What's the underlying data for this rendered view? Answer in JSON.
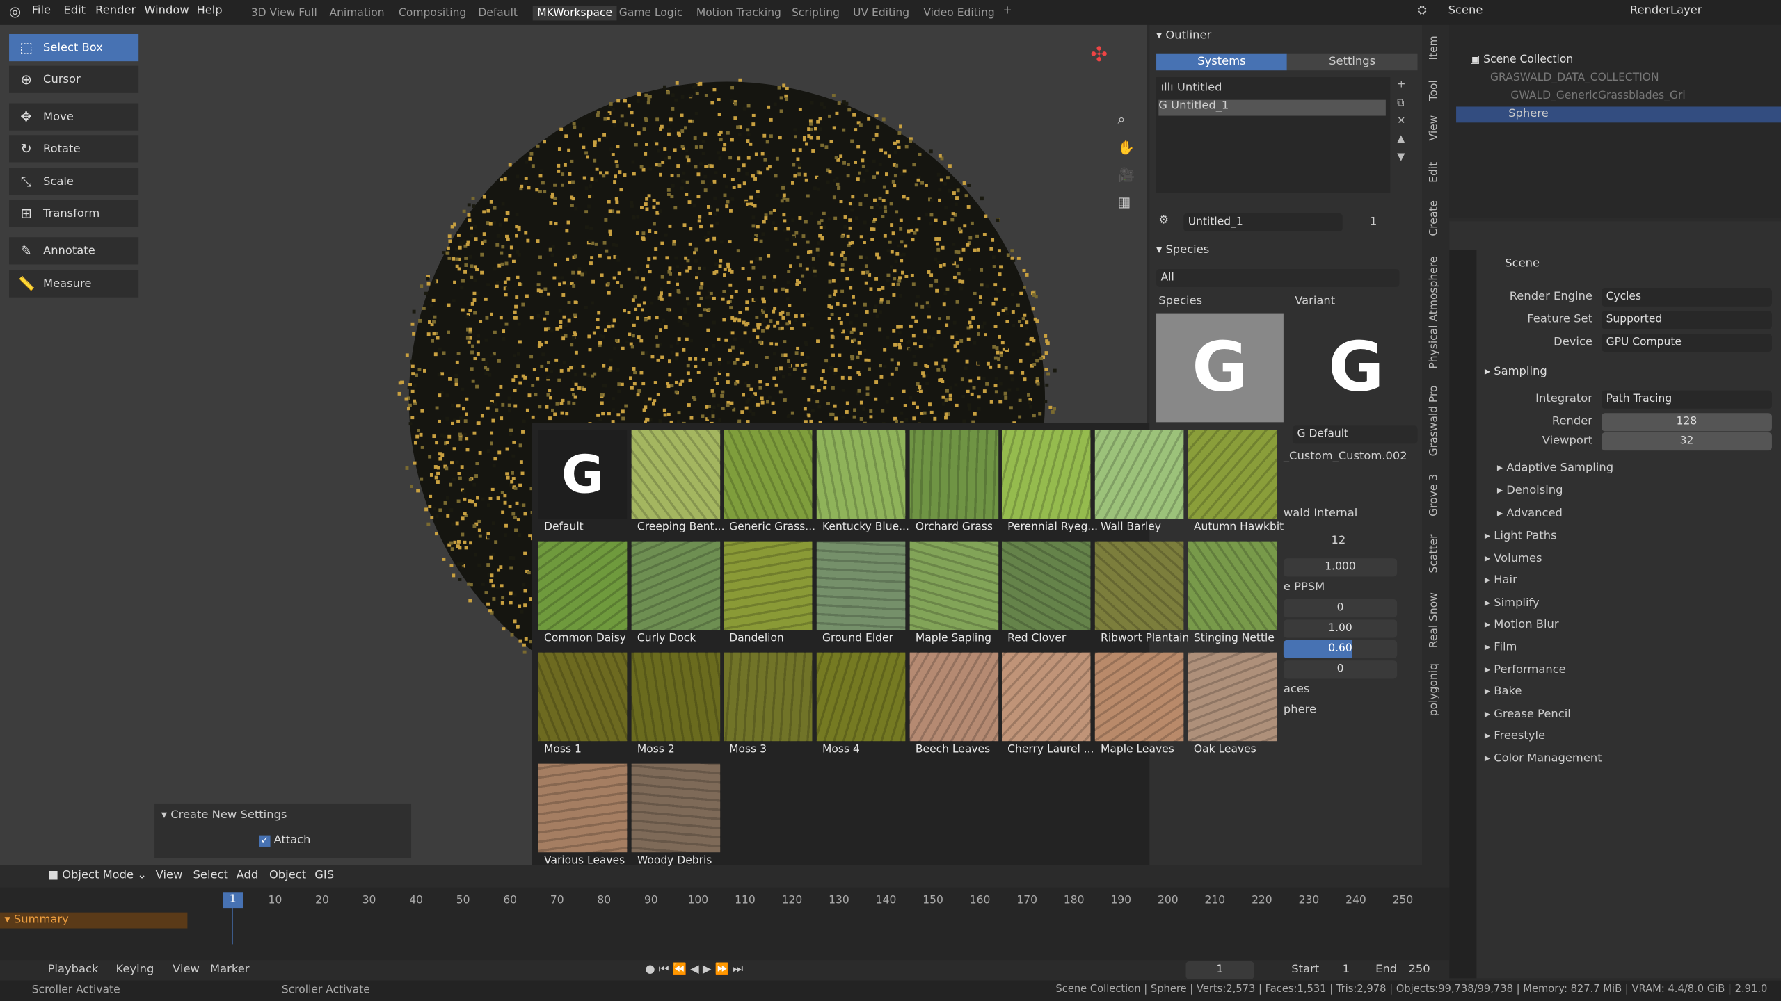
{
  "menu": [
    "File",
    "Edit",
    "Render",
    "Window",
    "Help"
  ],
  "workspaces": [
    "3D View Full",
    "Animation",
    "Compositing",
    "Default",
    "MKWorkspace",
    "Game Logic",
    "Motion Tracking",
    "Scripting",
    "UV Editing",
    "Video Editing"
  ],
  "active_workspace": "MKWorkspace",
  "scene": {
    "label": "Scene",
    "layer": "RenderLayer"
  },
  "tools": [
    "Select Box",
    "Cursor",
    "Move",
    "Rotate",
    "Scale",
    "Transform",
    "Annotate",
    "Measure"
  ],
  "tool_icons": [
    "select-box-icon",
    "cursor-icon",
    "move-icon",
    "rotate-icon",
    "scale-icon",
    "transform-icon",
    "annotate-icon",
    "measure-icon"
  ],
  "last_op": {
    "title": "Create New Settings",
    "attach": "Attach",
    "attach_checked": true
  },
  "viewport_header": {
    "mode": "Object Mode",
    "items": [
      "View",
      "Select",
      "Add",
      "Object",
      "GIS"
    ]
  },
  "graswald": {
    "outliner_title": "Outliner",
    "tab_systems": "Systems",
    "tab_settings": "Settings",
    "systems": [
      "Untitled",
      "Untitled_1"
    ],
    "settings_name": "Untitled_1",
    "users": "1",
    "species_title": "Species",
    "filter": "All",
    "species_label": "Species",
    "variant_label": "Variant",
    "variant_value": "Default",
    "custom": "_Custom_Custom.002",
    "internal": "wald Internal",
    "count": "12",
    "v1": "1.000",
    "ppsm": "e PPSM",
    "values": [
      "0",
      "1.00",
      "0.60",
      "0"
    ],
    "faces": "aces",
    "sphere": "phere"
  },
  "assets": [
    {
      "name": "Default",
      "color": "#1e1e1e"
    },
    {
      "name": "Creeping Bent...",
      "color": "#a4b660"
    },
    {
      "name": "Generic Grass...",
      "color": "#7f9e3c"
    },
    {
      "name": "Kentucky Blue...",
      "color": "#8fb35a"
    },
    {
      "name": "Orchard Grass",
      "color": "#6f9444"
    },
    {
      "name": "Perennial Ryeg...",
      "color": "#95bb4e"
    },
    {
      "name": "Wall Barley",
      "color": "#9cc27a"
    },
    {
      "name": "Autumn Hawkbit",
      "color": "#8a9e3a"
    },
    {
      "name": "Common Daisy",
      "color": "#6f9a3d"
    },
    {
      "name": "Curly Dock",
      "color": "#6e8f52"
    },
    {
      "name": "Dandelion",
      "color": "#8a9a36"
    },
    {
      "name": "Ground Elder",
      "color": "#75906a"
    },
    {
      "name": "Maple Sapling",
      "color": "#82a458"
    },
    {
      "name": "Red Clover",
      "color": "#65834a"
    },
    {
      "name": "Ribwort Plantain",
      "color": "#7c7e3c"
    },
    {
      "name": "Stinging Nettle",
      "color": "#789a4a"
    },
    {
      "name": "Moss 1",
      "color": "#6d6a20"
    },
    {
      "name": "Moss 2",
      "color": "#6a6b1e"
    },
    {
      "name": "Moss 3",
      "color": "#717428"
    },
    {
      "name": "Moss 4",
      "color": "#757a22"
    },
    {
      "name": "Beech Leaves",
      "color": "#b58a72"
    },
    {
      "name": "Cherry Laurel ...",
      "color": "#c09478"
    },
    {
      "name": "Maple Leaves",
      "color": "#b98a6a"
    },
    {
      "name": "Oak Leaves",
      "color": "#ae907a"
    },
    {
      "name": "Various Leaves",
      "color": "#a57e62"
    },
    {
      "name": "Woody Debris",
      "color": "#7e6a58"
    }
  ],
  "side_tabs": [
    "Item",
    "Tool",
    "View",
    "Edit",
    "Create",
    "Physical Atmosphere",
    "Graswald Pro",
    "Grove 3",
    "Scatter",
    "Real Snow",
    "polygoniq"
  ],
  "outliner": {
    "root": "Scene Collection",
    "rows": [
      "GRASWALD_DATA_COLLECTION",
      "GWALD_GenericGrassblades_Gri",
      "Sphere"
    ]
  },
  "properties": {
    "context": "Scene",
    "fields": [
      {
        "label": "Render Engine",
        "value": "Cycles"
      },
      {
        "label": "Feature Set",
        "value": "Supported"
      },
      {
        "label": "Device",
        "value": "GPU Compute"
      }
    ],
    "sampling": "Sampling",
    "integrator_label": "Integrator",
    "integrator": "Path Tracing",
    "render_label": "Render",
    "render": "128",
    "viewport_label": "Viewport",
    "viewport": "32",
    "sub": [
      "Adaptive Sampling",
      "Denoising",
      "Advanced"
    ],
    "panels": [
      "Light Paths",
      "Volumes",
      "Hair",
      "Simplify",
      "Motion Blur",
      "Film",
      "Performance",
      "Bake",
      "Grease Pencil",
      "Freestyle",
      "Color Management"
    ]
  },
  "timeline": {
    "summary": "Summary",
    "current": "1",
    "ticks": [
      "10",
      "20",
      "30",
      "40",
      "50",
      "60",
      "70",
      "80",
      "90",
      "100",
      "110",
      "120",
      "130",
      "140",
      "150",
      "160",
      "170",
      "180",
      "190",
      "200",
      "210",
      "220",
      "230",
      "240",
      "250"
    ],
    "menu": [
      "Playback",
      "Keying",
      "View",
      "Marker"
    ],
    "frame": "1",
    "start_label": "Start",
    "start": "1",
    "end_label": "End",
    "end": "250"
  },
  "status": {
    "left1": "Scroller Activate",
    "left2": "Scroller Activate",
    "right": "Scene Collection | Sphere | Verts:2,573 | Faces:1,531 | Tris:2,978 | Objects:99,738/99,738 | Memory: 827.7 MiB | VRAM: 4.4/8.0 GiB | 2.91.0"
  },
  "colors": {
    "accent": "#4772b3",
    "bg": "#3d3d3d",
    "panel": "#2a2a2a"
  }
}
